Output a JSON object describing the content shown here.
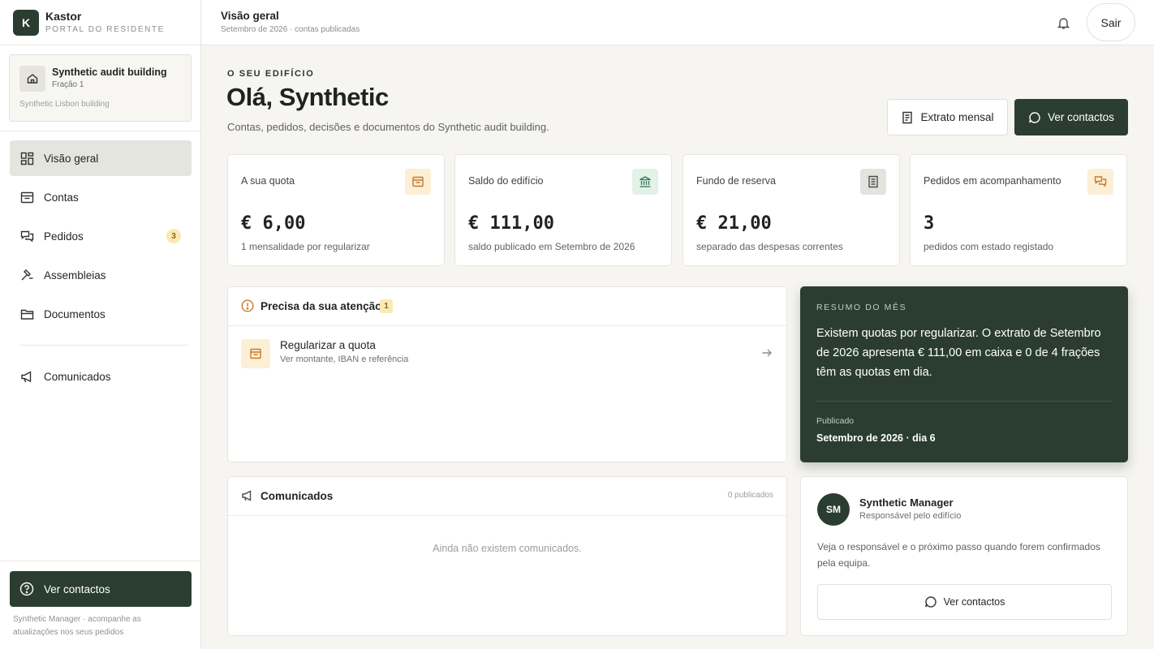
{
  "brand": {
    "logo_letter": "K",
    "name": "Kastor",
    "subtitle": "PORTAL DO RESIDENTE"
  },
  "building": {
    "name": "Synthetic audit building",
    "unit": "Fração 1",
    "note": "Synthetic Lisbon building"
  },
  "sidebar": {
    "items": [
      {
        "label": "Visão geral",
        "icon": "grid-icon",
        "active": true
      },
      {
        "label": "Contas",
        "icon": "wallet-icon"
      },
      {
        "label": "Pedidos",
        "icon": "chat-icon",
        "badge": "3"
      },
      {
        "label": "Assembleias",
        "icon": "gavel-icon"
      },
      {
        "label": "Documentos",
        "icon": "folder-icon"
      },
      {
        "label": "Comunicados",
        "icon": "megaphone-icon"
      }
    ],
    "cta_label": "Ver contactos",
    "footer": "Synthetic Manager · acompanhe as atualizações nos seus pedidos"
  },
  "topbar": {
    "title": "Visão geral",
    "subtitle": "Setembro de 2026 · contas publicadas",
    "logout_label": "Sair"
  },
  "header": {
    "eyebrow": "O SEU EDIFÍCIO",
    "greeting": "Olá, Synthetic",
    "subtitle": "Contas, pedidos, decisões e documentos do Synthetic audit building.",
    "statement_button": "Extrato mensal",
    "contacts_button": "Ver contactos"
  },
  "stats": [
    {
      "label": "A sua quota",
      "value": "€ 6,00",
      "note": "1 mensalidade por regularizar",
      "icon": "wallet-icon",
      "color": "#c7782a"
    },
    {
      "label": "Saldo do edifício",
      "value": "€ 111,00",
      "note": "saldo publicado em Setembro de 2026",
      "icon": "bank-icon",
      "color": "#2f7a52"
    },
    {
      "label": "Fundo de reserva",
      "value": "€ 21,00",
      "note": "separado das despesas correntes",
      "icon": "document-icon",
      "color": "#4a4f4b"
    },
    {
      "label": "Pedidos em acompanhamento",
      "value": "3",
      "note": "pedidos com estado registado",
      "icon": "chat-icon",
      "color": "#c7782a"
    }
  ],
  "attention": {
    "title": "Precisa da sua atenção",
    "count": "1",
    "items": [
      {
        "title": "Regularizar a quota",
        "subtitle": "Ver montante, IBAN e referência"
      }
    ]
  },
  "summary": {
    "eyebrow": "RESUMO DO MÊS",
    "text": "Existem quotas por regularizar. O extrato de Setembro de 2026 apresenta € 111,00 em caixa e 0 de 4 frações têm as quotas em dia.",
    "published_label": "Publicado",
    "published_value": "Setembro de 2026 · dia 6"
  },
  "announcements": {
    "title": "Comunicados",
    "count_label": "0 publicados",
    "empty": "Ainda não existem comunicados."
  },
  "manager": {
    "initials": "SM",
    "name": "Synthetic Manager",
    "role": "Responsável pelo edifício",
    "text": "Veja o responsável e o próximo passo quando forem confirmados pela equipa.",
    "button": "Ver contactos"
  },
  "colors": {
    "primary": "#2b3d31",
    "background": "#f6f5f1",
    "badge": "#fbe9b4",
    "accent_orange": "#c7782a",
    "accent_green": "#2f7a52"
  }
}
